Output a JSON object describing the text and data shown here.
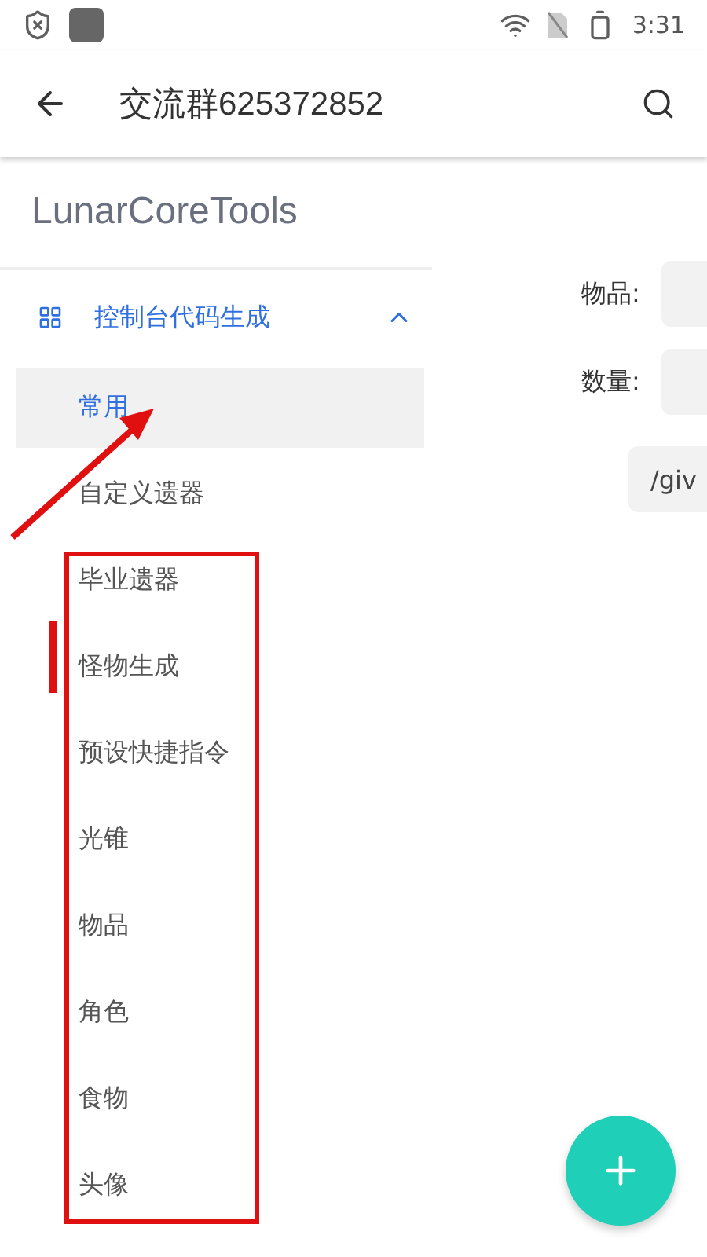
{
  "status_bar": {
    "time": "3:31"
  },
  "app_bar": {
    "title": "交流群625372852"
  },
  "drawer": {
    "header": "LunarCoreTools",
    "group": {
      "label": "控制台代码生成",
      "expanded": true,
      "items": [
        {
          "label": "常用",
          "selected": true
        },
        {
          "label": "自定义遗器",
          "selected": false
        },
        {
          "label": "毕业遗器",
          "selected": false
        },
        {
          "label": "怪物生成",
          "selected": false
        },
        {
          "label": "预设快捷指令",
          "selected": false
        },
        {
          "label": "光锥",
          "selected": false
        },
        {
          "label": "物品",
          "selected": false
        },
        {
          "label": "角色",
          "selected": false
        },
        {
          "label": "食物",
          "selected": false
        },
        {
          "label": "头像",
          "selected": false
        }
      ]
    }
  },
  "form": {
    "fields": [
      {
        "label": "物品:"
      },
      {
        "label": "数量:"
      }
    ],
    "command_button": "/giv"
  }
}
